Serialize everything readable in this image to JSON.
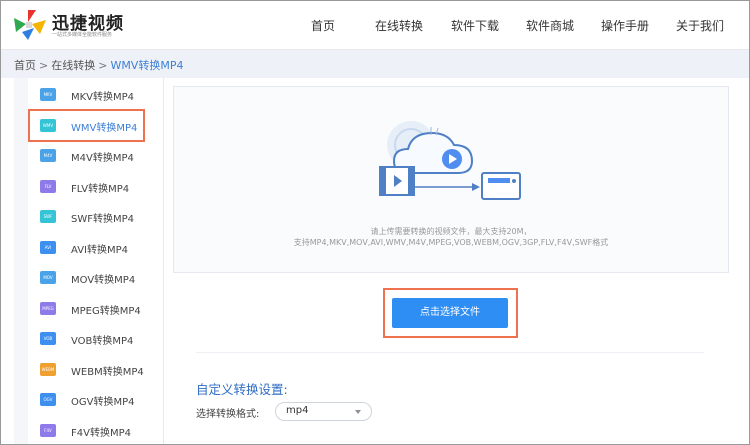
{
  "header": {
    "logo_title": "迅捷视频",
    "logo_subtitle": "一站式多媒体全能软件服务",
    "nav": [
      "首页",
      "在线转换",
      "软件下载",
      "软件商城",
      "操作手册",
      "关于我们"
    ]
  },
  "breadcrumb": {
    "items": [
      "首页",
      "在线转换",
      "WMV转换MP4"
    ],
    "separator": ">"
  },
  "sidebar": {
    "items": [
      {
        "icon_text": "MKV",
        "label": "MKV转换MP4",
        "color": "#4aa3e8"
      },
      {
        "icon_text": "WMV",
        "label": "WMV转换MP4",
        "color": "#35c4d6"
      },
      {
        "icon_text": "M4V",
        "label": "M4V转换MP4",
        "color": "#4aa3e8"
      },
      {
        "icon_text": "FLV",
        "label": "FLV转换MP4",
        "color": "#8e7ae8"
      },
      {
        "icon_text": "SWF",
        "label": "SWF转换MP4",
        "color": "#35c4d6"
      },
      {
        "icon_text": "AVI",
        "label": "AVI转换MP4",
        "color": "#3d8ff0"
      },
      {
        "icon_text": "MOV",
        "label": "MOV转换MP4",
        "color": "#4aa3e8"
      },
      {
        "icon_text": "MPEG",
        "label": "MPEG转换MP4",
        "color": "#8e7ae8"
      },
      {
        "icon_text": "VOB",
        "label": "VOB转换MP4",
        "color": "#3d8ff0"
      },
      {
        "icon_text": "WEBM",
        "label": "WEBM转换MP4",
        "color": "#f0a030"
      },
      {
        "icon_text": "OGV",
        "label": "OGV转换MP4",
        "color": "#3d8ff0"
      },
      {
        "icon_text": "F4V",
        "label": "F4V转换MP4",
        "color": "#8e7ae8"
      }
    ],
    "active_index": 1
  },
  "upload": {
    "hint_line1": "请上传需要转换的视频文件，最大支持20M，",
    "hint_line2": "支持MP4,MKV,MOV,AVI,WMV,M4V,MPEG,VOB,WEBM,OGV,3GP,FLV,F4V,SWF格式",
    "button_label": "点击选择文件"
  },
  "custom": {
    "title": "自定义转换设置:",
    "format_label": "选择转换格式:",
    "format_value": "mp4"
  },
  "colors": {
    "accent": "#2f8ef4",
    "highlight": "#ee7150",
    "link": "#3d7fd6"
  }
}
